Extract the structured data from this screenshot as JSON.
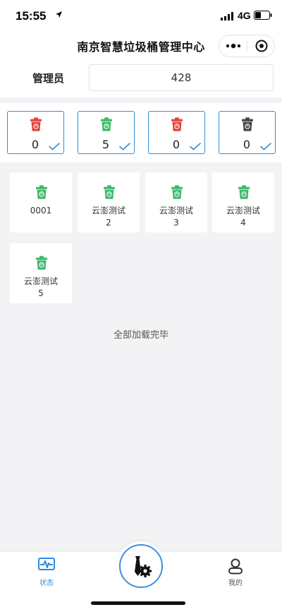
{
  "status_bar": {
    "time": "15:55",
    "network": "4G"
  },
  "nav": {
    "title": "南京智慧垃圾桶管理中心"
  },
  "admin": {
    "label": "管理员",
    "value": "428"
  },
  "summary": [
    {
      "color": "#e0443a",
      "count": "0"
    },
    {
      "color": "#3db86a",
      "count": "5"
    },
    {
      "color": "#e0443a",
      "count": "0"
    },
    {
      "color": "#444444",
      "count": "0"
    }
  ],
  "bins": [
    {
      "line1": "0001",
      "line2": ""
    },
    {
      "line1": "云澎测试",
      "line2": "2"
    },
    {
      "line1": "云澎测试",
      "line2": "3"
    },
    {
      "line1": "云澎测试",
      "line2": "4"
    },
    {
      "line1": "云澎测试",
      "line2": "5"
    }
  ],
  "bin_color": "#3db86a",
  "load_done": "全部加载完毕",
  "tabs": {
    "status": "状态",
    "mine": "我的"
  },
  "colors": {
    "accent": "#2a8be0",
    "card_border": "#2e8fd5"
  }
}
